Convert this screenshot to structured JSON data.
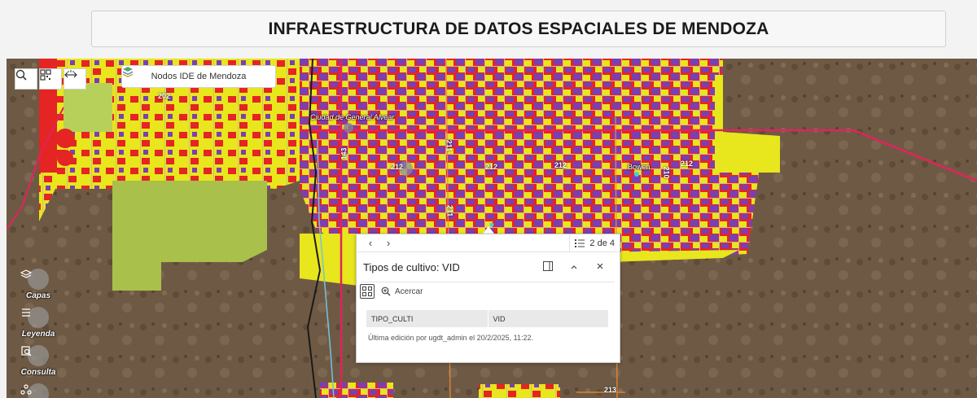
{
  "header": {
    "title": "INFRAESTRUCTURA DE DATOS ESPACIALES DE MENDOZA"
  },
  "map_toolbar": {
    "search_icon": "search-icon",
    "qr_icon": "qr-code-icon",
    "measure_icon": "measure-icon",
    "nodos_label": "Nodos IDE de Mendoza"
  },
  "map_labels": {
    "city": "Ciudad de General Alvear",
    "town": "Bowen",
    "roads": [
      "202",
      "143",
      "212",
      "212",
      "211",
      "211",
      "212",
      "212",
      "210",
      "213"
    ]
  },
  "side_tools": [
    {
      "label": "Capas",
      "icon": "layers-icon"
    },
    {
      "label": "Leyenda",
      "icon": "legend-icon"
    },
    {
      "label": "Consulta",
      "icon": "query-icon"
    }
  ],
  "popup": {
    "counter": "2 de 4",
    "title": "Tipos de cultivo: VID",
    "zoom_label": "Acercar",
    "table": {
      "field": "TIPO_CULTI",
      "value": "VID"
    },
    "edit_note": "Última edición por ugdt_admin el 20/2/2025, 11:22."
  },
  "colors": {
    "vineyard_purple": "#7a3fb3",
    "crop_red": "#e52424",
    "crop_yellow": "#e8e61c",
    "fallow_green": "#a9c04a",
    "road_red": "#e0245c",
    "terrain_brown": "#6e5a44"
  }
}
